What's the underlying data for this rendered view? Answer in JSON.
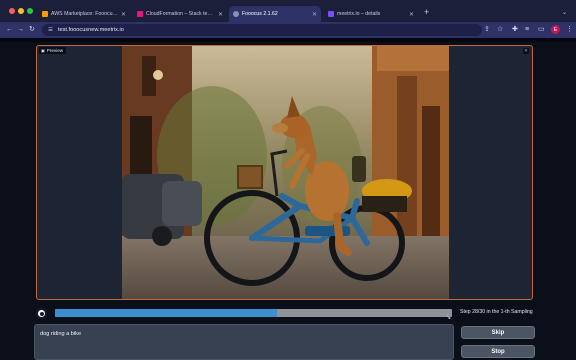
{
  "browser": {
    "tabs": [
      {
        "title": "AWS Marketplace: Fooocus 2...",
        "favicon_color": "#ff9900",
        "active": false
      },
      {
        "title": "CloudFormation – Stack testi...",
        "favicon_color": "#e7157b",
        "active": false
      },
      {
        "title": "Fooocus 2.1.62",
        "favicon_color": "#8a8fb8",
        "active": true
      },
      {
        "title": "meetrix.io – details",
        "favicon_color": "#7c4dff",
        "active": false
      }
    ],
    "new_tab_symbol": "+",
    "url": "test.fooocusnew.meetrix.io",
    "profile_initial": "E",
    "icons": [
      "back-arrow-icon",
      "forward-arrow-icon",
      "reload-icon",
      "site-info-icon",
      "share-icon",
      "bookmark-star-icon",
      "extensions-icon",
      "reading-list-icon",
      "sidebar-icon",
      "profile-avatar",
      "menu-dots-icon"
    ]
  },
  "app": {
    "gallery_label": "Preview",
    "progress_fraction": 0.56,
    "step_status": "Step 28/30 in the 1-th Sampling",
    "prompt_value": "dog riding a bike",
    "skip_label": "Skip",
    "stop_label": "Stop",
    "colors": {
      "accent_border": "#c4693b",
      "progress": "#3b8fd1",
      "background": "#0b0f19"
    }
  }
}
